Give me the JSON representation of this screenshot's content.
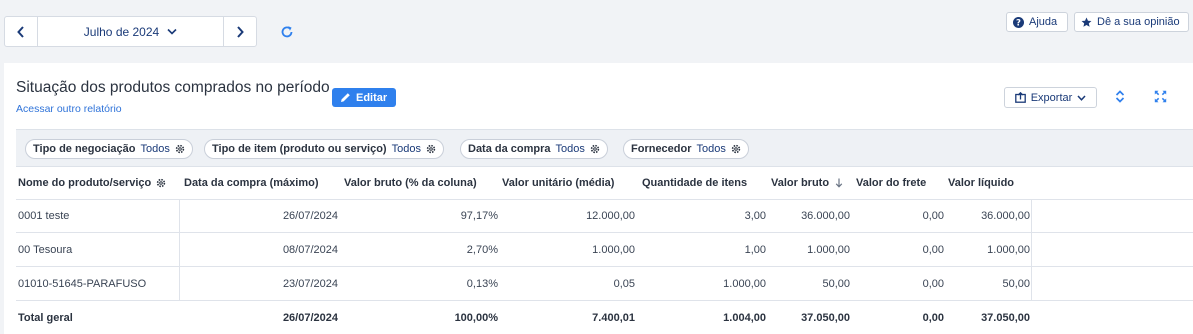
{
  "topbar": {
    "month_label": "Julho de 2024",
    "help_label": "Ajuda",
    "feedback_label": "Dê a sua opinião"
  },
  "report": {
    "title": "Situação dos produtos comprados no período",
    "other_report_link": "Acessar outro relatório",
    "edit_label": "Editar",
    "export_label": "Exportar"
  },
  "filters": [
    {
      "name": "Tipo de negociação",
      "value": "Todos"
    },
    {
      "name": "Tipo de item (produto ou serviço)",
      "value": "Todos"
    },
    {
      "name": "Data da compra",
      "value": "Todos"
    },
    {
      "name": "Fornecedor",
      "value": "Todos"
    }
  ],
  "table": {
    "headers": [
      "Nome do produto/serviço",
      "Data da compra (máximo)",
      "Valor bruto (% da coluna)",
      "Valor unitário (média)",
      "Quantidade de itens",
      "Valor bruto",
      "Valor do frete",
      "Valor líquido"
    ],
    "rows": [
      [
        "0001 teste",
        "26/07/2024",
        "97,17%",
        "12.000,00",
        "3,00",
        "36.000,00",
        "0,00",
        "36.000,00"
      ],
      [
        "00 Tesoura",
        "08/07/2024",
        "2,70%",
        "1.000,00",
        "1,00",
        "1.000,00",
        "0,00",
        "1.000,00"
      ],
      [
        "01010-51645-PARAFUSO",
        "23/07/2024",
        "0,13%",
        "0,05",
        "1.000,00",
        "50,00",
        "0,00",
        "50,00"
      ]
    ],
    "total": [
      "Total geral",
      "26/07/2024",
      "100,00%",
      "7.400,01",
      "1.004,00",
      "37.050,00",
      "0,00",
      "37.050,00"
    ]
  },
  "colors": {
    "accent": "#2f80ed",
    "navy": "#1a3a78",
    "link": "#2f73d9"
  }
}
